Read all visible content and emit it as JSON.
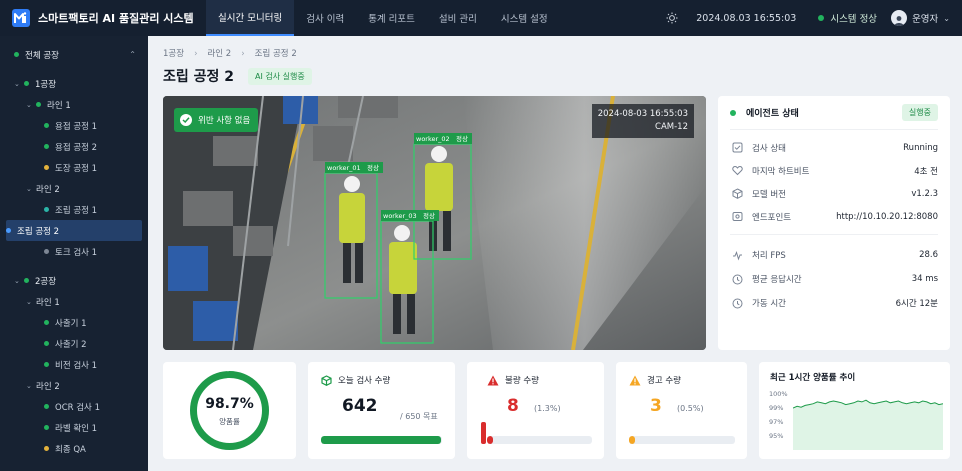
{
  "app": {
    "title": "스마트팩토리 AI 품질관리 시스템"
  },
  "nav": {
    "items": [
      {
        "label": "실시간 모니터링",
        "active": true
      },
      {
        "label": "검사 이력",
        "active": false
      },
      {
        "label": "통계 리포트",
        "active": false
      },
      {
        "label": "설비 관리",
        "active": false
      },
      {
        "label": "시스템 설정",
        "active": false
      }
    ]
  },
  "header": {
    "datetime": "2024.08.03   16:55:03",
    "system_status": "시스템 정상",
    "user_name": "운영자",
    "theme_icon": "sun-icon"
  },
  "sidebar": {
    "root": "전체 공장",
    "factories": [
      {
        "name": "1공장",
        "lines": [
          {
            "name": "라인 1",
            "processes": [
              {
                "name": "용접 공정 1",
                "status": "green"
              },
              {
                "name": "용접 공정 2",
                "status": "green"
              },
              {
                "name": "도장 공정 1",
                "status": "yellow"
              }
            ]
          },
          {
            "name": "라인 2",
            "processes": [
              {
                "name": "조립 공정 1",
                "status": "teal"
              },
              {
                "name": "조립 공정 2",
                "status": "blue",
                "selected": true
              },
              {
                "name": "토크 검사 1",
                "status": "gray"
              }
            ]
          }
        ]
      },
      {
        "name": "2공장",
        "lines": [
          {
            "name": "라인 1",
            "processes": [
              {
                "name": "사출기 1",
                "status": "green"
              },
              {
                "name": "사출기 2",
                "status": "green"
              },
              {
                "name": "비전 검사 1",
                "status": "green"
              }
            ]
          },
          {
            "name": "라인 2",
            "processes": [
              {
                "name": "OCR 검사 1",
                "status": "green"
              },
              {
                "name": "라벨 확인 1",
                "status": "green"
              },
              {
                "name": "최종 QA",
                "status": "yellow"
              }
            ]
          }
        ]
      }
    ]
  },
  "breadcrumb": [
    "1공장",
    "라인 2",
    "조립 공정 2"
  ],
  "page": {
    "title": "조립 공정 2",
    "badge": "AI 검사 실행중"
  },
  "camera": {
    "status_badge": "위반 사항 없음",
    "timestamp": "2024-08-03 16:55:03",
    "camera_id": "CAM-12",
    "detections": [
      {
        "id": "worker_01",
        "state": "정상"
      },
      {
        "id": "worker_02",
        "state": "정상"
      },
      {
        "id": "worker_03",
        "state": "정상"
      }
    ]
  },
  "agent": {
    "title": "에이전트 상태",
    "status_badge": "실행중",
    "rows": [
      {
        "icon": "search-check-icon",
        "label": "검사 상태",
        "value": "Running"
      },
      {
        "icon": "heart-icon",
        "label": "마지막 하트비트",
        "value": "4초 전"
      },
      {
        "icon": "cube-icon",
        "label": "모델 버전",
        "value": "v1.2.3"
      },
      {
        "icon": "link-icon",
        "label": "엔드포인트",
        "value": "http://10.10.20.12:8080"
      }
    ],
    "metrics": [
      {
        "icon": "pulse-icon",
        "label": "처리 FPS",
        "value": "28.6"
      },
      {
        "icon": "clock-icon",
        "label": "평균 응답시간",
        "value": "34 ms"
      },
      {
        "icon": "clock-icon",
        "label": "가동 시간",
        "value": "6시간 12분"
      }
    ]
  },
  "yield_card": {
    "value": "98.7%",
    "label": "양품률",
    "ratio": 0.987,
    "color": "#1e9b4a"
  },
  "inspection_card": {
    "title": "오늘 검사 수량",
    "value": "642",
    "target": "/ 650 목표",
    "progress": 0.988,
    "color": "#1e9b4a"
  },
  "defect_card": {
    "title": "불량 수량",
    "value": "8",
    "percent": "(1.3%)",
    "progress": 0.013,
    "color": "#d92d2d"
  },
  "warning_card": {
    "title": "경고 수량",
    "value": "3",
    "percent": "(0.5%)",
    "progress": 0.005,
    "color": "#f5a623"
  },
  "trend_card": {
    "title": "최근 1시간 양품률 추이",
    "chart_data": {
      "type": "area",
      "y_ticks": [
        "100%",
        "99%",
        "97%",
        "95%"
      ],
      "values": [
        98.4,
        98.6,
        98.5,
        98.7,
        98.8,
        98.9,
        99.1,
        99.0,
        98.9,
        99.1,
        99.2,
        99.1,
        99.0,
        98.8,
        98.9,
        99.0,
        99.2,
        99.1,
        99.3,
        99.0,
        98.9,
        99.0,
        99.1,
        99.2,
        99.0,
        99.1,
        99.2,
        99.0,
        98.9,
        99.0,
        99.1,
        99.0,
        99.2,
        99.1,
        98.9,
        99.0,
        98.8,
        98.9
      ],
      "grid": false
    }
  }
}
